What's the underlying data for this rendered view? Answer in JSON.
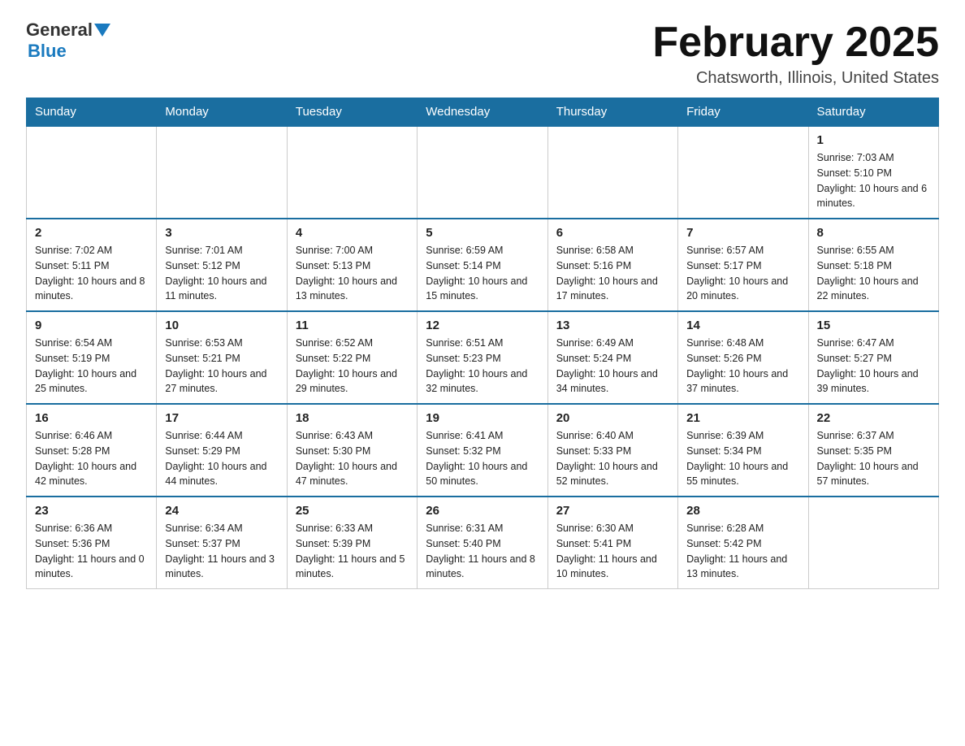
{
  "logo": {
    "general": "General",
    "blue": "Blue"
  },
  "header": {
    "month_year": "February 2025",
    "location": "Chatsworth, Illinois, United States"
  },
  "days_of_week": [
    "Sunday",
    "Monday",
    "Tuesday",
    "Wednesday",
    "Thursday",
    "Friday",
    "Saturday"
  ],
  "weeks": [
    [
      {
        "day": "",
        "info": ""
      },
      {
        "day": "",
        "info": ""
      },
      {
        "day": "",
        "info": ""
      },
      {
        "day": "",
        "info": ""
      },
      {
        "day": "",
        "info": ""
      },
      {
        "day": "",
        "info": ""
      },
      {
        "day": "1",
        "info": "Sunrise: 7:03 AM\nSunset: 5:10 PM\nDaylight: 10 hours and 6 minutes."
      }
    ],
    [
      {
        "day": "2",
        "info": "Sunrise: 7:02 AM\nSunset: 5:11 PM\nDaylight: 10 hours and 8 minutes."
      },
      {
        "day": "3",
        "info": "Sunrise: 7:01 AM\nSunset: 5:12 PM\nDaylight: 10 hours and 11 minutes."
      },
      {
        "day": "4",
        "info": "Sunrise: 7:00 AM\nSunset: 5:13 PM\nDaylight: 10 hours and 13 minutes."
      },
      {
        "day": "5",
        "info": "Sunrise: 6:59 AM\nSunset: 5:14 PM\nDaylight: 10 hours and 15 minutes."
      },
      {
        "day": "6",
        "info": "Sunrise: 6:58 AM\nSunset: 5:16 PM\nDaylight: 10 hours and 17 minutes."
      },
      {
        "day": "7",
        "info": "Sunrise: 6:57 AM\nSunset: 5:17 PM\nDaylight: 10 hours and 20 minutes."
      },
      {
        "day": "8",
        "info": "Sunrise: 6:55 AM\nSunset: 5:18 PM\nDaylight: 10 hours and 22 minutes."
      }
    ],
    [
      {
        "day": "9",
        "info": "Sunrise: 6:54 AM\nSunset: 5:19 PM\nDaylight: 10 hours and 25 minutes."
      },
      {
        "day": "10",
        "info": "Sunrise: 6:53 AM\nSunset: 5:21 PM\nDaylight: 10 hours and 27 minutes."
      },
      {
        "day": "11",
        "info": "Sunrise: 6:52 AM\nSunset: 5:22 PM\nDaylight: 10 hours and 29 minutes."
      },
      {
        "day": "12",
        "info": "Sunrise: 6:51 AM\nSunset: 5:23 PM\nDaylight: 10 hours and 32 minutes."
      },
      {
        "day": "13",
        "info": "Sunrise: 6:49 AM\nSunset: 5:24 PM\nDaylight: 10 hours and 34 minutes."
      },
      {
        "day": "14",
        "info": "Sunrise: 6:48 AM\nSunset: 5:26 PM\nDaylight: 10 hours and 37 minutes."
      },
      {
        "day": "15",
        "info": "Sunrise: 6:47 AM\nSunset: 5:27 PM\nDaylight: 10 hours and 39 minutes."
      }
    ],
    [
      {
        "day": "16",
        "info": "Sunrise: 6:46 AM\nSunset: 5:28 PM\nDaylight: 10 hours and 42 minutes."
      },
      {
        "day": "17",
        "info": "Sunrise: 6:44 AM\nSunset: 5:29 PM\nDaylight: 10 hours and 44 minutes."
      },
      {
        "day": "18",
        "info": "Sunrise: 6:43 AM\nSunset: 5:30 PM\nDaylight: 10 hours and 47 minutes."
      },
      {
        "day": "19",
        "info": "Sunrise: 6:41 AM\nSunset: 5:32 PM\nDaylight: 10 hours and 50 minutes."
      },
      {
        "day": "20",
        "info": "Sunrise: 6:40 AM\nSunset: 5:33 PM\nDaylight: 10 hours and 52 minutes."
      },
      {
        "day": "21",
        "info": "Sunrise: 6:39 AM\nSunset: 5:34 PM\nDaylight: 10 hours and 55 minutes."
      },
      {
        "day": "22",
        "info": "Sunrise: 6:37 AM\nSunset: 5:35 PM\nDaylight: 10 hours and 57 minutes."
      }
    ],
    [
      {
        "day": "23",
        "info": "Sunrise: 6:36 AM\nSunset: 5:36 PM\nDaylight: 11 hours and 0 minutes."
      },
      {
        "day": "24",
        "info": "Sunrise: 6:34 AM\nSunset: 5:37 PM\nDaylight: 11 hours and 3 minutes."
      },
      {
        "day": "25",
        "info": "Sunrise: 6:33 AM\nSunset: 5:39 PM\nDaylight: 11 hours and 5 minutes."
      },
      {
        "day": "26",
        "info": "Sunrise: 6:31 AM\nSunset: 5:40 PM\nDaylight: 11 hours and 8 minutes."
      },
      {
        "day": "27",
        "info": "Sunrise: 6:30 AM\nSunset: 5:41 PM\nDaylight: 11 hours and 10 minutes."
      },
      {
        "day": "28",
        "info": "Sunrise: 6:28 AM\nSunset: 5:42 PM\nDaylight: 11 hours and 13 minutes."
      },
      {
        "day": "",
        "info": ""
      }
    ]
  ]
}
